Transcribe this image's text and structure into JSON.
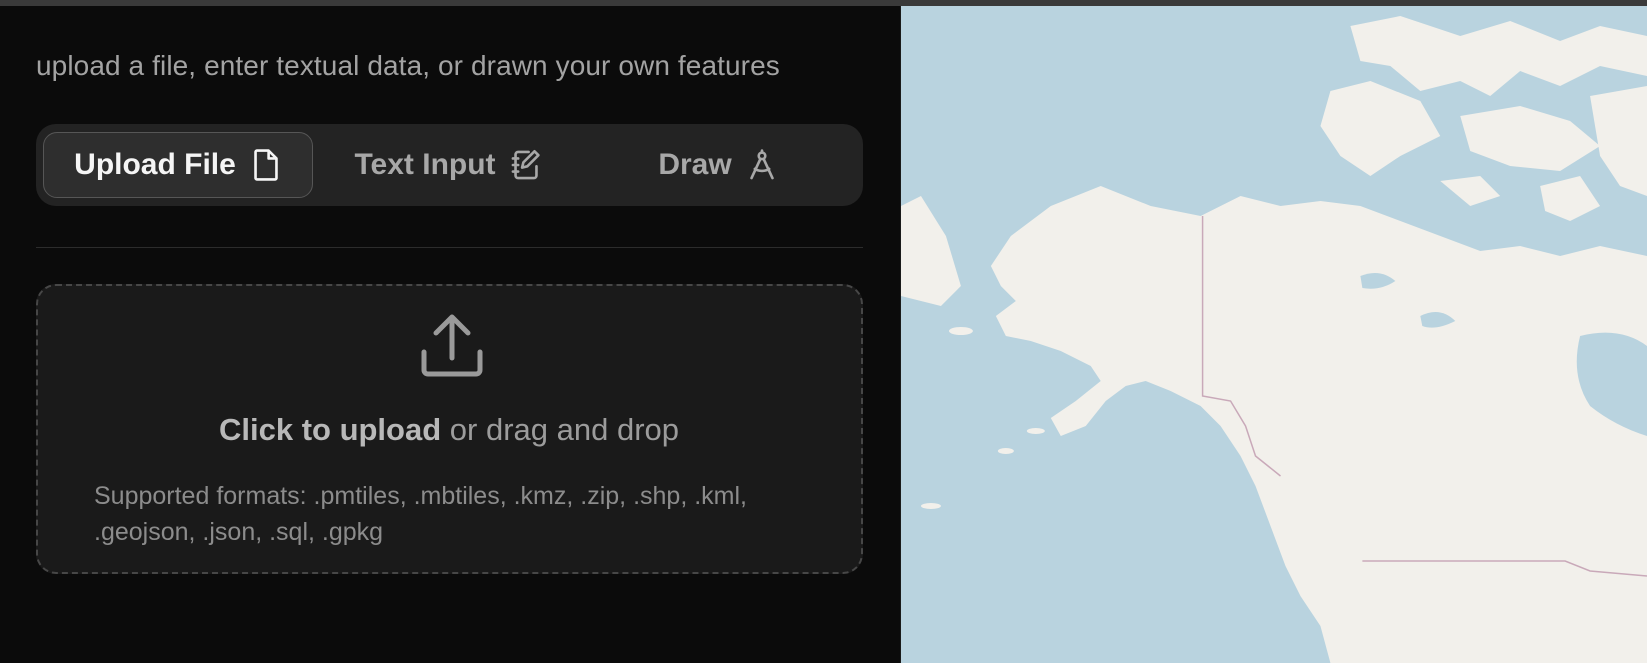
{
  "header": {
    "subtitle": "upload a file, enter textual data, or drawn your own features"
  },
  "tabs": [
    {
      "label": "Upload File",
      "icon": "file-icon",
      "active": true
    },
    {
      "label": "Text Input",
      "icon": "notebook-pen-icon",
      "active": false
    },
    {
      "label": "Draw",
      "icon": "compass-drafting-icon",
      "active": false
    }
  ],
  "dropzone": {
    "icon": "upload-icon",
    "cta_bold": "Click to upload",
    "cta_rest": " or drag and drop",
    "formats": "Supported formats: .pmtiles, .mbtiles, .kmz, .zip, .shp, .kml, .geojson, .json, .sql, .gpkg"
  },
  "map": {
    "water_color": "#b9d3df",
    "land_color": "#f2f0eb",
    "border_color": "#c9a9b9"
  },
  "colors": {
    "panel_bg": "#0b0b0b",
    "tabs_bg": "#232323",
    "active_tab_bg": "#2e2e2e",
    "dropzone_bg": "#1a1a1a"
  }
}
